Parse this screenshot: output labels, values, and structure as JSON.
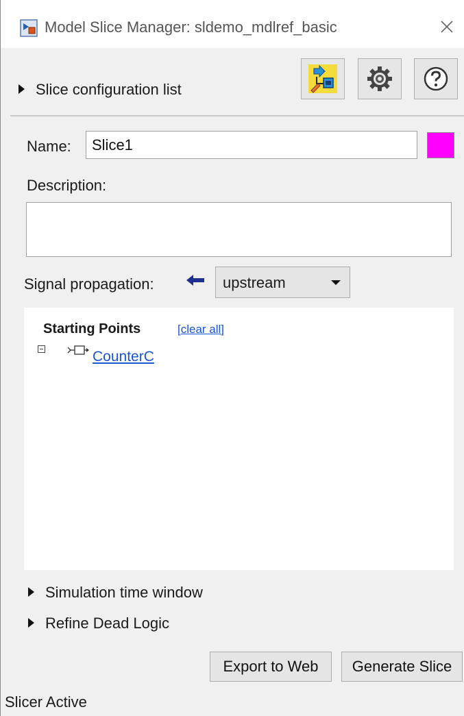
{
  "window": {
    "title": "Model Slice Manager: sldemo_mdlref_basic",
    "close_icon": "close-icon",
    "app_icon": "simulink-model-icon"
  },
  "config": {
    "toggle_label": "Slice configuration list",
    "toolbar": {
      "slicer_icon": "highlight-slice-icon",
      "settings_icon": "gear-icon",
      "help_icon": "help-icon"
    }
  },
  "name": {
    "label": "Name:",
    "value": "Slice1",
    "color": "#ff00ff"
  },
  "description": {
    "label": "Description:",
    "value": ""
  },
  "signal": {
    "label": "Signal propagation:",
    "direction_icon": "arrow-left-icon",
    "arrow_color": "#1f2f8f",
    "selected": "upstream"
  },
  "starting_points": {
    "title": "Starting Points",
    "clear_all": "[clear all]",
    "items": [
      {
        "label": "CounterC",
        "icon": "block-icon"
      }
    ]
  },
  "sections": {
    "simulation_time_window": "Simulation time window",
    "refine_dead_logic": "Refine Dead Logic"
  },
  "buttons": {
    "export": "Export to Web",
    "generate": "Generate Slice"
  },
  "status": {
    "text": "Slicer Active"
  }
}
